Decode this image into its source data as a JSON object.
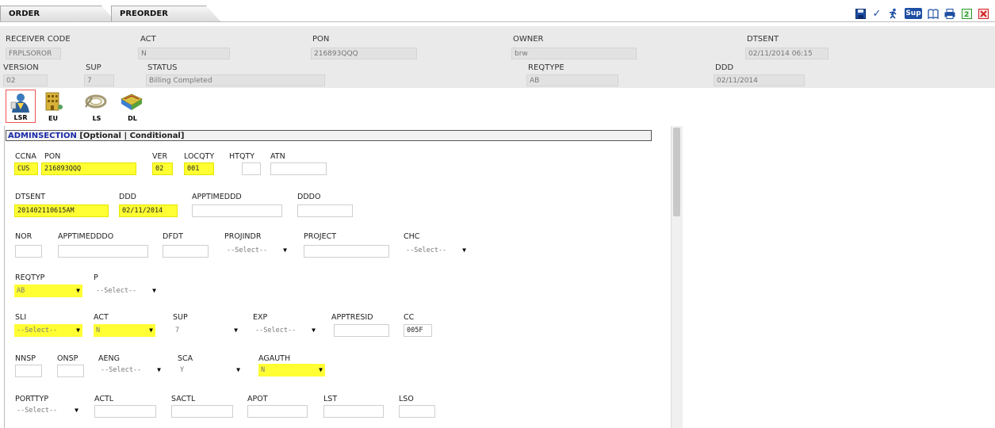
{
  "tabs": [
    {
      "label": "ORDER"
    },
    {
      "label": "PREORDER"
    }
  ],
  "toolbar": {
    "save_icon": "save-icon",
    "check_icon": "check-icon",
    "run_icon": "run-icon",
    "sup_label": "Sup",
    "book_icon": "book-icon",
    "print_icon": "print-icon",
    "refresh_icon": "refresh-icon",
    "close_icon": "close-icon"
  },
  "header": {
    "receiver_code": {
      "label": "RECEIVER CODE",
      "value": "FRPLSOROR"
    },
    "act": {
      "label": "ACT",
      "value": "N"
    },
    "pon": {
      "label": "PON",
      "value": "216893QQQ"
    },
    "owner": {
      "label": "OWNER",
      "value": "brw"
    },
    "dtsent": {
      "label": "DTSENT",
      "value": "02/11/2014 06:15"
    },
    "version": {
      "label": "VERSION",
      "value": "02"
    },
    "sup": {
      "label": "SUP",
      "value": "7"
    },
    "status": {
      "label": "STATUS",
      "value": "Billing Completed"
    },
    "reqtype": {
      "label": "REQTYPE",
      "value": "AB"
    },
    "ddd": {
      "label": "DDD",
      "value": "02/11/2014"
    }
  },
  "sections": [
    {
      "label": "LSR"
    },
    {
      "label": "EU"
    },
    {
      "label": "LS"
    },
    {
      "label": "DL"
    }
  ],
  "admin": {
    "title": "ADMINSECTION",
    "subtitle": "[Optional | Conditional]",
    "select_placeholder": "--Select--",
    "fields": {
      "ccna": {
        "label": "CCNA",
        "value": "CUS"
      },
      "pon": {
        "label": "PON",
        "value": "216893QQQ"
      },
      "ver": {
        "label": "VER",
        "value": "02"
      },
      "locqty": {
        "label": "LOCQTY",
        "value": "001"
      },
      "htqty": {
        "label": "HTQTY",
        "value": ""
      },
      "atn": {
        "label": "ATN",
        "value": ""
      },
      "dtsent": {
        "label": "DTSENT",
        "value": "201402110615AM"
      },
      "ddd": {
        "label": "DDD",
        "value": "02/11/2014"
      },
      "apptimeddd": {
        "label": "APPTIMEDDD",
        "value": ""
      },
      "dddo": {
        "label": "DDDO",
        "value": ""
      },
      "nor": {
        "label": "NOR",
        "value": ""
      },
      "apptimedddo": {
        "label": "APPTIMEDDDO",
        "value": ""
      },
      "dfdt": {
        "label": "DFDT",
        "value": ""
      },
      "projindr": {
        "label": "PROJINDR",
        "value": "--Select--"
      },
      "project": {
        "label": "PROJECT",
        "value": ""
      },
      "chc": {
        "label": "CHC",
        "value": "--Select--"
      },
      "reqtyp": {
        "label": "REQTYP",
        "value": "AB"
      },
      "p": {
        "label": "P",
        "value": "--Select--"
      },
      "sli": {
        "label": "SLI",
        "value": "--Select--"
      },
      "act": {
        "label": "ACT",
        "value": "N"
      },
      "sup": {
        "label": "SUP",
        "value": "7"
      },
      "exp": {
        "label": "EXP",
        "value": "--Select--"
      },
      "apptresid": {
        "label": "APPTRESID",
        "value": ""
      },
      "cc": {
        "label": "CC",
        "value": "005F"
      },
      "nnsp": {
        "label": "NNSP",
        "value": ""
      },
      "onsp": {
        "label": "ONSP",
        "value": ""
      },
      "aeng": {
        "label": "AENG",
        "value": "--Select--"
      },
      "sca": {
        "label": "SCA",
        "value": "Y"
      },
      "agauth": {
        "label": "AGAUTH",
        "value": "N"
      },
      "porttyp": {
        "label": "PORTTYP",
        "value": "--Select--"
      },
      "actl": {
        "label": "ACTL",
        "value": ""
      },
      "sactl": {
        "label": "SACTL",
        "value": ""
      },
      "apot": {
        "label": "APOT",
        "value": ""
      },
      "lst": {
        "label": "LST",
        "value": ""
      },
      "lso": {
        "label": "LSO",
        "value": ""
      }
    }
  }
}
